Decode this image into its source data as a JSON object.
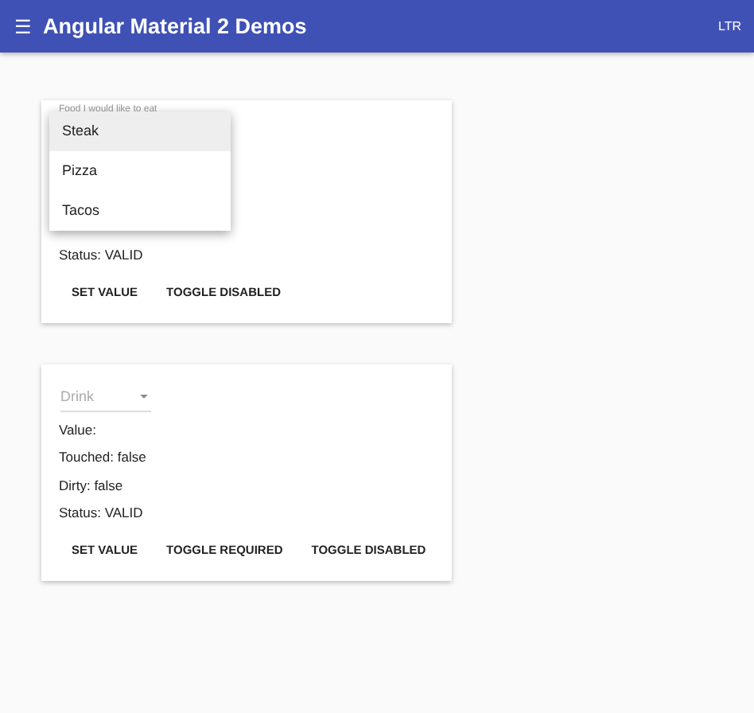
{
  "toolbar": {
    "menu_icon": "☰",
    "title": "Angular Material 2 Demos",
    "direction": "LTR"
  },
  "cards": [
    {
      "select": {
        "label": "Food I would like to eat",
        "open": true,
        "options": [
          {
            "label": "Steak",
            "selected": true
          },
          {
            "label": "Pizza",
            "selected": false
          },
          {
            "label": "Tacos",
            "selected": false
          }
        ]
      },
      "lines": [
        "Status: VALID"
      ],
      "buttons": [
        "SET VALUE",
        "TOGGLE DISABLED"
      ]
    },
    {
      "select": {
        "placeholder": "Drink",
        "open": false
      },
      "lines": [
        "Value:",
        "Touched: false",
        "Dirty: false",
        "Status: VALID"
      ],
      "buttons": [
        "SET VALUE",
        "TOGGLE REQUIRED",
        "TOGGLE DISABLED"
      ]
    }
  ]
}
